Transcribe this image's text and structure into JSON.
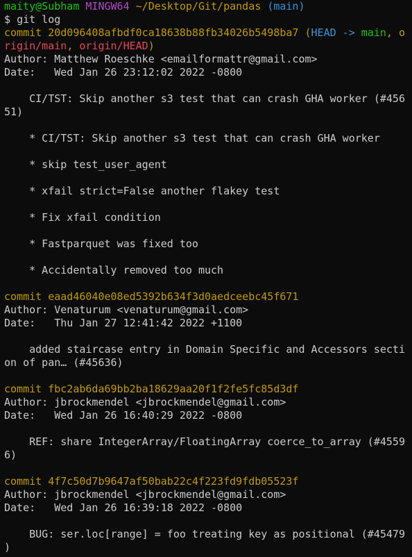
{
  "prompt": {
    "user_host": "maity@Subham",
    "env": "MINGW64",
    "path": "~/Desktop/Git/pandas",
    "branch": "(main)",
    "symbol": "$",
    "command": "git log"
  },
  "commits": [
    {
      "label": "commit",
      "hash": "20d096408afbdf0ca18638b88fb34026b5498ba7",
      "refs": {
        "open": " (",
        "head": "HEAD -> ",
        "main": "main",
        "sep1": ", o",
        "rest": "rigin/main",
        "sep2": ", ",
        "origin_head": "origin/HEAD",
        "close": ")"
      },
      "author": "Author: Matthew Roeschke <emailformattr@gmail.com>",
      "date": "Date:   Wed Jan 26 23:12:02 2022 -0800",
      "message_lines": [
        "    CI/TST: Skip another s3 test that can crash GHA worker (#456",
        "51)",
        "",
        "    * CI/TST: Skip another s3 test that can crash GHA worker",
        "",
        "    * skip test_user_agent",
        "",
        "    * xfail strict=False another flakey test",
        "",
        "    * Fix xfail condition",
        "",
        "    * Fastparquet was fixed too",
        "",
        "    * Accidentally removed too much"
      ]
    },
    {
      "label": "commit",
      "hash": "eaad46040e08ed5392b634f3d0aedceebc45f671",
      "author": "Author: Venaturum <venaturum@gmail.com>",
      "date": "Date:   Thu Jan 27 12:41:42 2022 +1100",
      "message_lines": [
        "    added staircase entry in Domain Specific and Accessors secti",
        "on of pan… (#45636)"
      ]
    },
    {
      "label": "commit",
      "hash": "fbc2ab6da69bb2ba18629aa20f1f2fe5fc85d3df",
      "author": "Author: jbrockmendel <jbrockmendel@gmail.com>",
      "date": "Date:   Wed Jan 26 16:40:29 2022 -0800",
      "message_lines": [
        "    REF: share IntegerArray/FloatingArray coerce_to_array (#4559",
        "6)"
      ]
    },
    {
      "label": "commit",
      "hash": "4f7c50d7b9647af50bab22c4f223fd9fdb05523f",
      "author": "Author: jbrockmendel <jbrockmendel@gmail.com>",
      "date": "Date:   Wed Jan 26 16:39:18 2022 -0800",
      "message_lines": [
        "    BUG: ser.loc[range] = foo treating key as positional (#45479",
        ")"
      ]
    }
  ],
  "colors": {
    "background": "#0c0c0c",
    "text": "#cccccc",
    "green": "#16c60c",
    "magenta": "#b148c6",
    "yellow": "#c19c00",
    "cyan": "#3a96dd",
    "red": "#e74856"
  }
}
